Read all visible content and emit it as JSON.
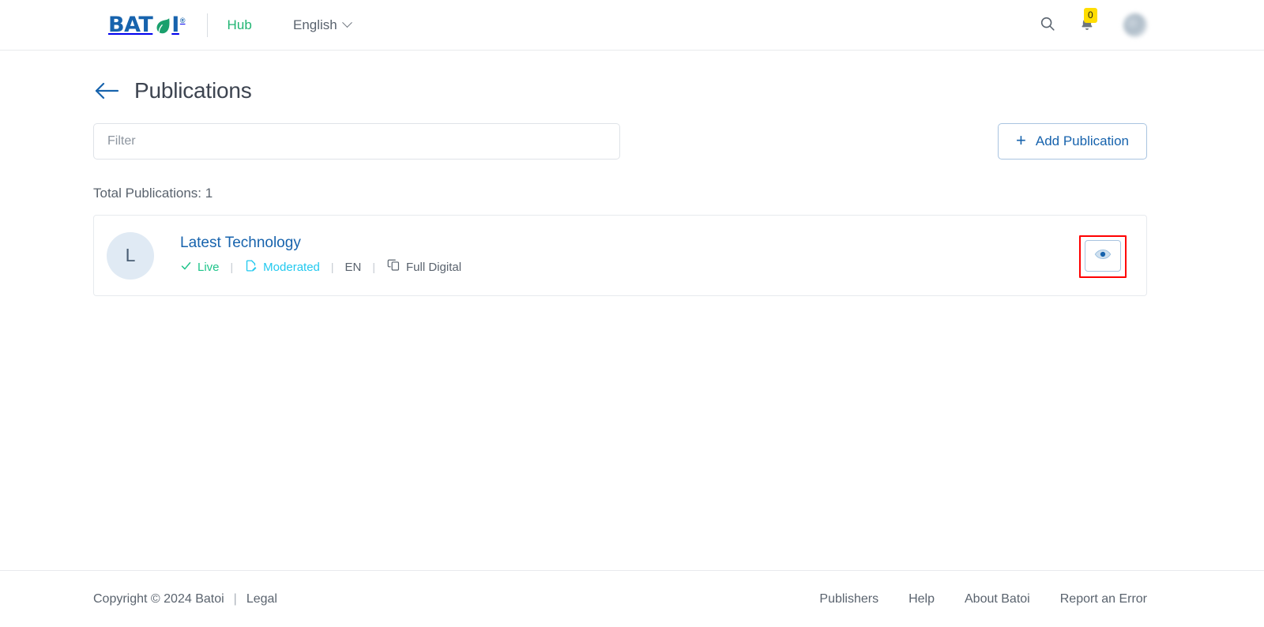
{
  "header": {
    "logo": {
      "text_before": "BAT",
      "text_after": "I",
      "registered": "®",
      "leaf_color": "#1aa06d",
      "word_color": "#1763ad"
    },
    "hub_label": "Hub",
    "language": {
      "label": "English",
      "chevron_icon": "chevron-down-icon"
    },
    "search_icon": "search-icon",
    "notifications": {
      "bell_icon": "bell-icon",
      "count": "0",
      "badge_color": "#ffdd00"
    },
    "avatar_label": ""
  },
  "page": {
    "back_icon": "arrow-left-icon",
    "title": "Publications"
  },
  "toolbar": {
    "filter_placeholder": "Filter",
    "filter_value": "",
    "add_icon": "plus-icon",
    "add_label": "Add Publication"
  },
  "summary": {
    "total_label": "Total Publications: 1"
  },
  "publications": [
    {
      "initial": "L",
      "title": "Latest Technology",
      "status": {
        "icon": "check-icon",
        "label": "Live",
        "color": "#1fc48a"
      },
      "moderation": {
        "icon": "document-edit-icon",
        "label": "Moderated",
        "color": "#22c9ef"
      },
      "language": "EN",
      "format": {
        "icon": "copy-icon",
        "label": "Full Digital"
      },
      "view_icon": "eye-icon",
      "separator": "|"
    }
  ],
  "footer": {
    "copyright": "Copyright © 2024 Batoi",
    "separator": "|",
    "legal_label": "Legal",
    "links": [
      {
        "label": "Publishers"
      },
      {
        "label": "Help"
      },
      {
        "label": "About Batoi"
      },
      {
        "label": "Report an Error"
      }
    ]
  }
}
